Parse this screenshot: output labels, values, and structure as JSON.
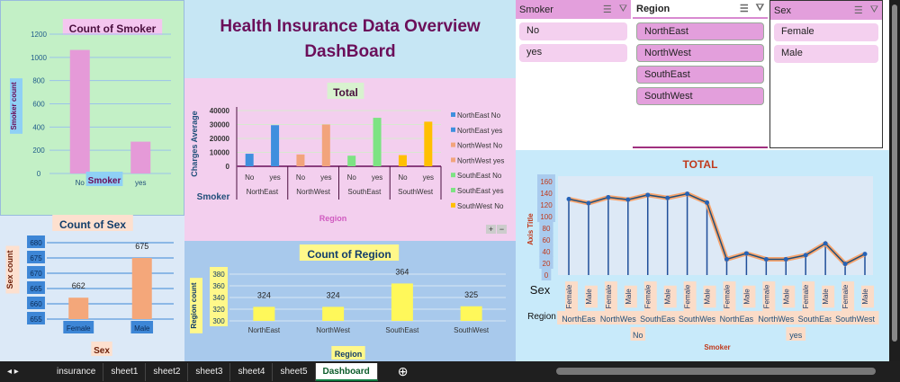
{
  "dashboard_title": "Health Insurance Data Overview DashBoard",
  "smoker_chart": {
    "title": "Count of Smoker",
    "ylabel": "Smoker count",
    "xlabel": "Smoker",
    "categories": [
      "No",
      "yes"
    ],
    "values": [
      1064,
      274
    ],
    "yticks": [
      0,
      200,
      400,
      600,
      800,
      1000,
      1200
    ],
    "ylim": [
      0,
      1200
    ],
    "bar_color": "#e59ad8"
  },
  "sex_chart": {
    "title": "Count of Sex",
    "ylabel": "Sex count",
    "xlabel": "Sex",
    "categories": [
      "Female",
      "Male"
    ],
    "values": [
      662,
      675
    ],
    "yticks": [
      655,
      660,
      665,
      670,
      675,
      680
    ],
    "ylim": [
      655,
      680
    ],
    "bar_color": "#f4a77a"
  },
  "region_chart": {
    "title": "Count of Region",
    "ylabel": "Region count",
    "xlabel": "Region",
    "categories": [
      "NorthEast",
      "NorthWest",
      "SouthEast",
      "SouthWest"
    ],
    "values": [
      324,
      324,
      364,
      325
    ],
    "yticks": [
      300,
      320,
      340,
      360,
      380
    ],
    "ylim": [
      300,
      380
    ],
    "bar_color": "#fff85a"
  },
  "total_chart": {
    "title": "Total",
    "ylabel": "Charges Average",
    "xlabel": "Region",
    "row_label": "Smoker",
    "groups": [
      "NorthEast",
      "NorthWest",
      "SouthEast",
      "SouthWest"
    ],
    "subcategories": [
      "No",
      "yes"
    ],
    "values": [
      9000,
      29500,
      8500,
      30000,
      7600,
      34800,
      8000,
      32000
    ],
    "yticks": [
      0,
      10000,
      20000,
      30000,
      40000
    ],
    "ylim": [
      0,
      40000
    ],
    "legend": [
      "NorthEast No",
      "NorthEast yes",
      "NorthWest No",
      "NorthWest yes",
      "SouthEast No",
      "SouthEast yes",
      "SouthWest No"
    ],
    "colors": [
      "#3f8fde",
      "#3f8fde",
      "#f2a47c",
      "#f2a47c",
      "#7de383",
      "#7de383",
      "#ffc000",
      "#ffc000"
    ]
  },
  "line_chart": {
    "title": "TOTAL",
    "ylabel": "Axis Title",
    "xlabel": "Smoker",
    "row1_label": "Sex",
    "row2_label": "Region",
    "yticks": [
      0,
      20,
      40,
      60,
      80,
      100,
      120,
      140,
      160
    ],
    "ylim": [
      0,
      160
    ],
    "smoker": [
      "No",
      "yes"
    ],
    "regions": [
      "NorthEas",
      "NorthWes",
      "SouthEas",
      "SouthWes",
      "NorthEas",
      "NorthWes",
      "SouthEas",
      "SouthWest"
    ],
    "sexes": [
      "Female",
      "Male"
    ],
    "values": [
      130,
      123,
      133,
      129,
      137,
      132,
      139,
      124,
      27,
      37,
      27,
      27,
      34,
      54,
      19,
      36
    ]
  },
  "slicers": [
    {
      "title": "Smoker",
      "items": [
        "No",
        "yes"
      ]
    },
    {
      "title": "Region",
      "items": [
        "NorthEast",
        "NorthWest",
        "SouthEast",
        "SouthWest"
      ]
    },
    {
      "title": "Sex",
      "items": [
        "Female",
        "Male"
      ]
    }
  ],
  "tabs": [
    "insurance",
    "sheet1",
    "sheet2",
    "sheet3",
    "sheet4",
    "sheet5",
    "Dashboard"
  ],
  "active_tab": "Dashboard",
  "zoom_buttons": [
    "+",
    "−"
  ]
}
